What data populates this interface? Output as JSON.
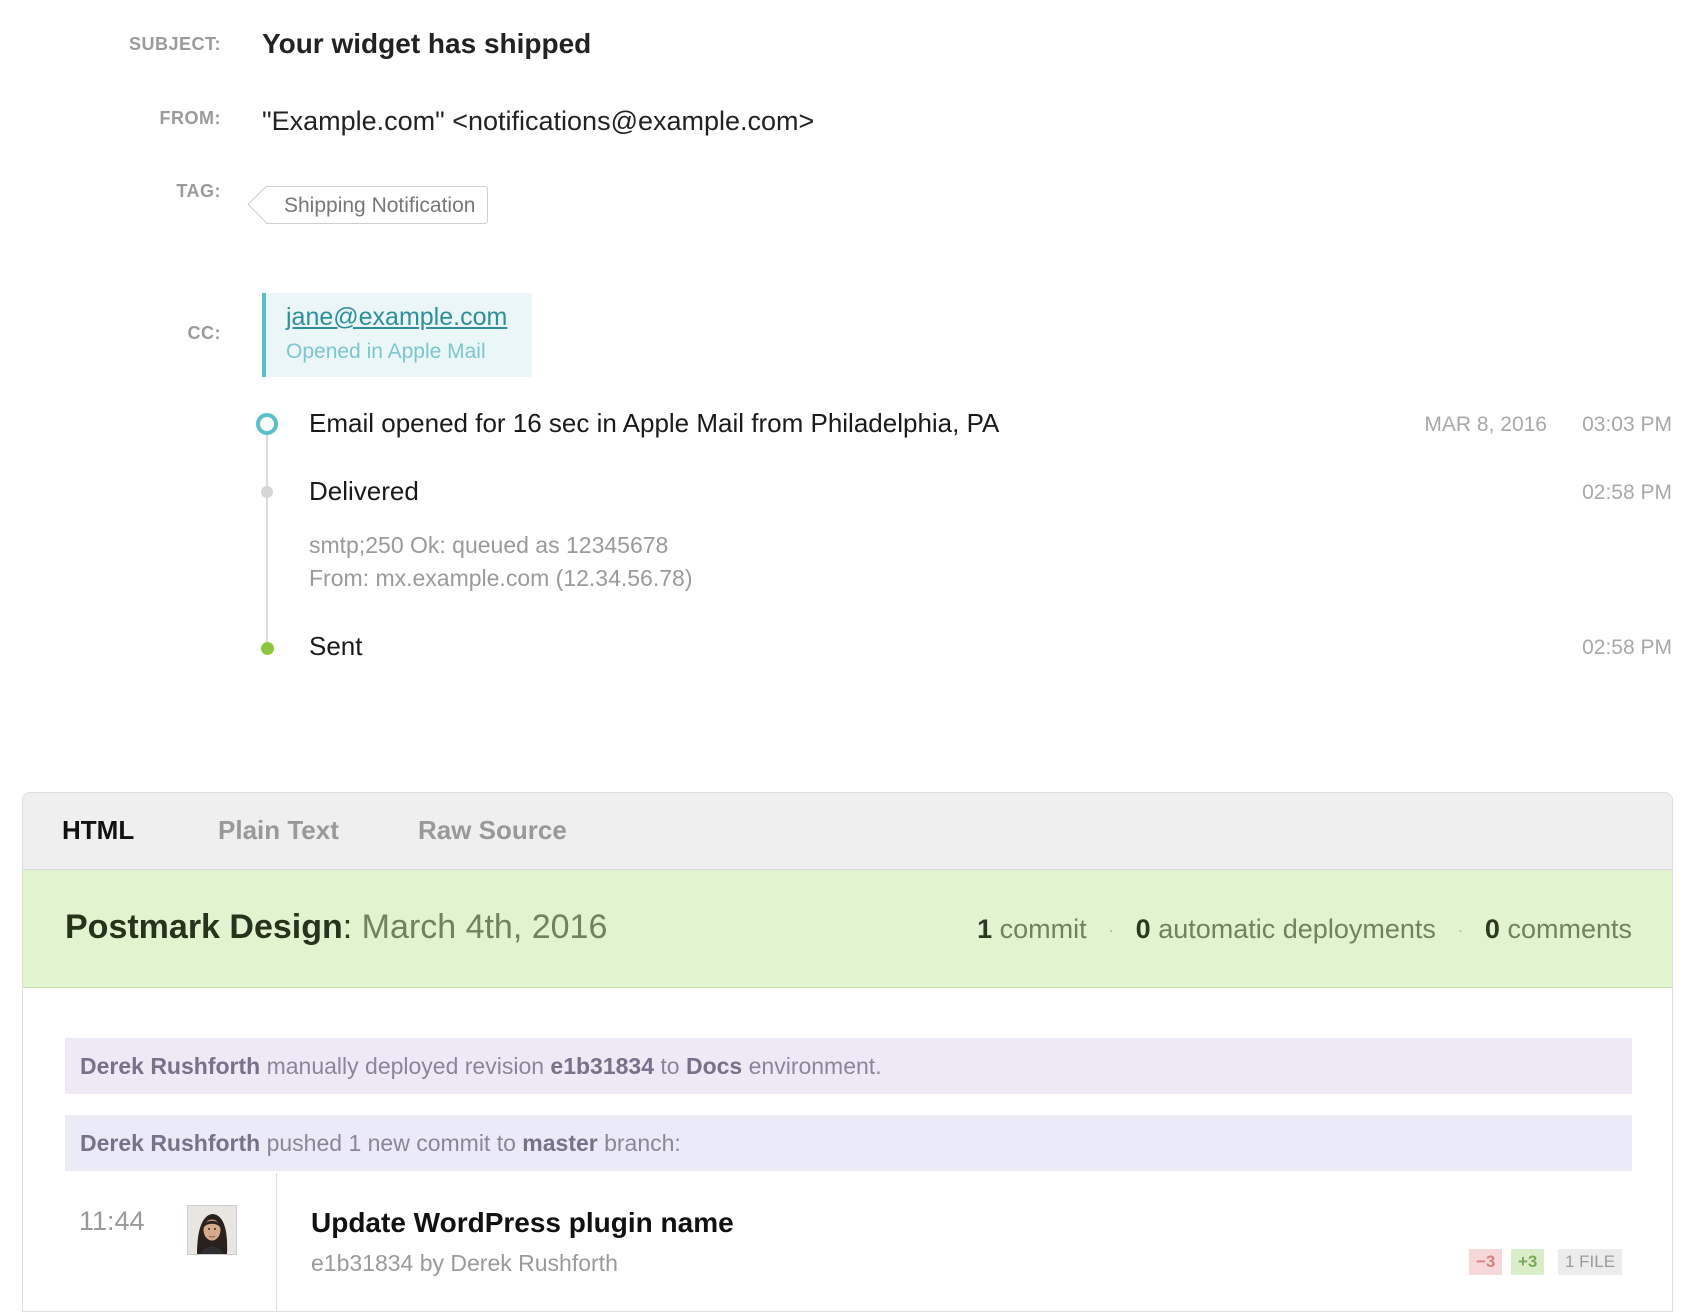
{
  "meta": {
    "subject_label": "SUBJECT:",
    "subject": "Your widget has shipped",
    "from_label": "FROM:",
    "from": "\"Example.com\" <notifications@example.com>",
    "tag_label": "TAG:",
    "tag": "Shipping Notification",
    "cc_label": "CC:",
    "cc_email": "jane@example.com",
    "cc_status": "Opened in Apple Mail"
  },
  "events": {
    "opened": {
      "title": "Email opened for 16 sec in Apple Mail from Philadelphia, PA",
      "date": "MAR 8, 2016",
      "time": "03:03 PM",
      "icon": "ring-marker-icon"
    },
    "delivered": {
      "title": "Delivered",
      "time": "02:58 PM",
      "detail_1": "smtp;250 Ok: queued as 12345678",
      "detail_2": "From: mx.example.com (12.34.56.78)"
    },
    "sent": {
      "title": "Sent",
      "time": "02:58 PM"
    }
  },
  "tabs": {
    "html": "HTML",
    "plain": "Plain Text",
    "raw": "Raw Source",
    "active": "HTML"
  },
  "banner": {
    "name": "Postmark Design",
    "colon": ":",
    "date": "March 4th, 2016",
    "commits_count": "1",
    "commits_label": "commit",
    "deploys_count": "0",
    "deploys_label": "automatic deployments",
    "comments_count": "0",
    "comments_label": "comments",
    "separator": "·"
  },
  "notices": {
    "deploy": {
      "user": "Derek Rushforth",
      "t1": "manually deployed revision",
      "revision": "e1b31834",
      "t2": "to",
      "env": "Docs",
      "t3": "environment."
    },
    "push": {
      "user": "Derek Rushforth",
      "t1": "pushed 1 new commit to",
      "branch": "master",
      "t2": "branch:"
    }
  },
  "commit": {
    "time": "11:44",
    "message": "Update WordPress plugin name",
    "meta": "e1b31834 by Derek Rushforth",
    "deletions": "−3",
    "additions": "+3",
    "files": "1 FILE"
  },
  "colors": {
    "accent_teal": "#5bbfca",
    "sent_green": "#8cc63f",
    "banner_green": "#e1f4cf"
  }
}
